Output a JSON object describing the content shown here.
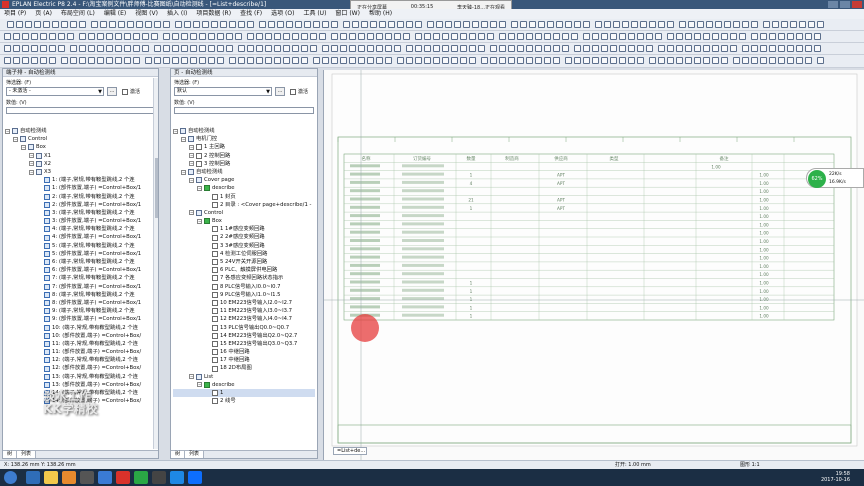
{
  "window": {
    "title": "EPLAN Electric P8 2.4 - F:\\淘宝案例文件\\胖师傅-比赛图纸\\自动检测线 - [=List+describe/1]"
  },
  "sharing": {
    "status": "正在分享屏幕",
    "time": "00:35:15",
    "viewer": "李天臻-18...正在观看"
  },
  "menu": [
    "项目 (P)",
    "页 (A)",
    "布局空间 (L)",
    "编辑 (E)",
    "视图 (V)",
    "插入 (I)",
    "项目数据 (R)",
    "查找 (F)",
    "选项 (O)",
    "工具 (U)",
    "窗口 (W)",
    "帮助 (H)"
  ],
  "left_panel": {
    "title": "端子排 - 自动检测线",
    "filter_label": "筛选器: (F)",
    "filter_value": "- 未激活 -",
    "activate_label": "激活",
    "value_label": "数值: (V)",
    "tree": [
      {
        "label": "自动检测线",
        "indent": 0
      },
      {
        "label": "Control",
        "indent": 1
      },
      {
        "label": "Box",
        "indent": 2
      },
      {
        "label": "X1",
        "indent": 3
      },
      {
        "label": "X2",
        "indent": 3
      },
      {
        "label": "X3",
        "indent": 3
      },
      {
        "label": "1: (端子,常规,带有鞍型跳线,2 个连",
        "indent": 4
      },
      {
        "label": "1: (部件放置,端子) =Control+Box/1",
        "indent": 4
      },
      {
        "label": "2: (端子,常规,带有鞍型跳线,2 个连",
        "indent": 4
      },
      {
        "label": "2: (部件放置,端子) =Control+Box/1",
        "indent": 4
      },
      {
        "label": "3: (端子,常规,带有鞍型跳线,2 个连",
        "indent": 4
      },
      {
        "label": "3: (部件放置,端子) =Control+Box/1",
        "indent": 4
      },
      {
        "label": "4: (端子,常规,带有鞍型跳线,2 个连",
        "indent": 4
      },
      {
        "label": "4: (部件放置,端子) =Control+Box/1",
        "indent": 4
      },
      {
        "label": "5: (端子,常规,带有鞍型跳线,2 个连",
        "indent": 4
      },
      {
        "label": "5: (部件放置,端子) =Control+Box/1",
        "indent": 4
      },
      {
        "label": "6: (端子,常规,带有鞍型跳线,2 个连",
        "indent": 4
      },
      {
        "label": "6: (部件放置,端子) =Control+Box/1",
        "indent": 4
      },
      {
        "label": "7: (端子,常规,带有鞍型跳线,2 个连",
        "indent": 4
      },
      {
        "label": "7: (部件放置,端子) =Control+Box/1",
        "indent": 4
      },
      {
        "label": "8: (端子,常规,带有鞍型跳线,2 个连",
        "indent": 4
      },
      {
        "label": "8: (部件放置,端子) =Control+Box/1",
        "indent": 4
      },
      {
        "label": "9: (端子,常规,带有鞍型跳线,2 个连",
        "indent": 4
      },
      {
        "label": "9: (部件放置,端子) =Control+Box/1",
        "indent": 4
      },
      {
        "label": "10: (端子,常规,带有鞍型跳线,2 个连",
        "indent": 4
      },
      {
        "label": "10: (部件放置,端子) =Control+Box/",
        "indent": 4
      },
      {
        "label": "11: (端子,常规,带有鞍型跳线,2 个连",
        "indent": 4
      },
      {
        "label": "11: (部件放置,端子) =Control+Box/",
        "indent": 4
      },
      {
        "label": "12: (端子,常规,带有鞍型跳线,2 个连",
        "indent": 4
      },
      {
        "label": "12: (部件放置,端子) =Control+Box/",
        "indent": 4
      },
      {
        "label": "13: (端子,常规,带有鞍型跳线,2 个连",
        "indent": 4
      },
      {
        "label": "13: (部件放置,端子) =Control+Box/",
        "indent": 4
      },
      {
        "label": "14: (端子,常规,带有鞍型跳线,2 个连",
        "indent": 4
      },
      {
        "label": "14: (部件放置,端子) =Control+Box/",
        "indent": 4
      }
    ],
    "tabs": [
      "树",
      "列表"
    ]
  },
  "mid_panel": {
    "title": "页 - 自动检测线",
    "filter_label": "筛选器: (F)",
    "filter_value": "默认",
    "activate_label": "激活",
    "value_label": "数值: (V)",
    "tree": [
      {
        "label": "自动检测线",
        "indent": 0,
        "icon": "folder"
      },
      {
        "label": "电机门控",
        "indent": 1,
        "icon": "folder"
      },
      {
        "label": "1 主回路",
        "indent": 2,
        "icon": "page"
      },
      {
        "label": "2 控制回路",
        "indent": 2,
        "icon": "page"
      },
      {
        "label": "3 控制回路",
        "indent": 2,
        "icon": "page"
      },
      {
        "label": "自动检测线",
        "indent": 1,
        "icon": "folder"
      },
      {
        "label": "Cover page",
        "indent": 2,
        "icon": "folder"
      },
      {
        "label": "describe",
        "indent": 3,
        "icon": "green"
      },
      {
        "label": "1 封页",
        "indent": 4,
        "icon": "page"
      },
      {
        "label": "2 目录 : <Cover page+describe/1 - ",
        "indent": 4,
        "icon": "page"
      },
      {
        "label": "Control",
        "indent": 2,
        "icon": "folder"
      },
      {
        "label": "Box",
        "indent": 3,
        "icon": "green"
      },
      {
        "label": "1 1#感应变频回路",
        "indent": 4,
        "icon": "page"
      },
      {
        "label": "2 2#感应变频回路",
        "indent": 4,
        "icon": "page"
      },
      {
        "label": "3 3#感应变频回路",
        "indent": 4,
        "icon": "page"
      },
      {
        "label": "4 检测工位伺服回路",
        "indent": 4,
        "icon": "page"
      },
      {
        "label": "5 24V开关开源回路",
        "indent": 4,
        "icon": "page"
      },
      {
        "label": "6 PLC、触摸屏供电回路",
        "indent": 4,
        "icon": "page"
      },
      {
        "label": "7 各感应变频回路状态指示",
        "indent": 4,
        "icon": "page"
      },
      {
        "label": "8 PLC信号输入I0.0~I0.7",
        "indent": 4,
        "icon": "page"
      },
      {
        "label": "9 PLC信号输入I1.0~I1.5",
        "indent": 4,
        "icon": "page"
      },
      {
        "label": "10 EM223信号输入I2.0~I2.7",
        "indent": 4,
        "icon": "page"
      },
      {
        "label": "11 EM223信号输入I3.0~I3.7",
        "indent": 4,
        "icon": "page"
      },
      {
        "label": "12 EM223信号输入I4.0~I4.7",
        "indent": 4,
        "icon": "page"
      },
      {
        "label": "13 PLC信号输出Q0.0~Q0.7",
        "indent": 4,
        "icon": "page"
      },
      {
        "label": "14 EM223信号输出Q2.0~Q2.7",
        "indent": 4,
        "icon": "page"
      },
      {
        "label": "15 EM223信号输出Q3.0~Q3.7",
        "indent": 4,
        "icon": "page"
      },
      {
        "label": "16 中继回路",
        "indent": 4,
        "icon": "page"
      },
      {
        "label": "17 中继回路",
        "indent": 4,
        "icon": "page"
      },
      {
        "label": "18 2D布局图",
        "indent": 4,
        "icon": "page"
      },
      {
        "label": "List",
        "indent": 2,
        "icon": "folder"
      },
      {
        "label": "describe",
        "indent": 3,
        "icon": "green"
      },
      {
        "label": "1",
        "indent": 4,
        "icon": "page",
        "selected": true
      },
      {
        "label": "2 线号",
        "indent": 4,
        "icon": "page"
      }
    ],
    "tabs": [
      "树",
      "列表"
    ]
  },
  "drawing": {
    "doc_tab": "=List+de...",
    "table_headers": [
      "名称",
      "订货编号",
      "数量",
      "制造商",
      "供应商",
      "类型",
      "备注"
    ],
    "rows": [
      [
        "",
        "",
        "",
        "",
        "",
        "",
        "",
        "1.00"
      ],
      [
        "塑壳断路器",
        "",
        "1",
        "",
        "APT",
        "",
        "1.00"
      ],
      [
        "微型断路器",
        "",
        "4",
        "",
        "APT",
        "",
        "1.00"
      ],
      [
        "",
        "",
        "",
        "",
        "",
        "",
        "1.00"
      ],
      [
        "",
        "",
        "21",
        "",
        "APT",
        "",
        "1.00"
      ],
      [
        "",
        "",
        "1",
        "",
        "APT",
        "",
        "1.00"
      ],
      [
        "",
        "",
        "",
        "",
        "",
        "",
        "1.00"
      ],
      [
        "",
        "",
        "",
        "",
        "",
        "",
        "1.00"
      ],
      [
        "",
        "",
        "",
        "",
        "",
        "",
        "1.00"
      ],
      [
        "",
        "",
        "",
        "",
        "",
        "",
        "1.00"
      ],
      [
        "",
        "",
        "",
        "",
        "",
        "",
        "1.00"
      ],
      [
        "",
        "",
        "",
        "",
        "",
        "",
        "1.00"
      ],
      [
        "",
        "",
        "",
        "",
        "",
        "",
        "1.00"
      ],
      [
        "",
        "",
        "",
        "",
        "",
        "",
        "1.00"
      ],
      [
        "",
        "",
        "1",
        "",
        "",
        "",
        "1.00"
      ],
      [
        "",
        "",
        "1",
        "",
        "",
        "",
        "1.00"
      ],
      [
        "",
        "",
        "1",
        "",
        "",
        "",
        "1.00"
      ],
      [
        "",
        "",
        "1",
        "",
        "",
        "",
        "1.00"
      ],
      [
        "",
        "",
        "1",
        "",
        "",
        "",
        "1.00"
      ]
    ]
  },
  "status": {
    "coords": "X: 138.26 mm  Y: 138.26 mm",
    "grid": "打开: 1.00 mm",
    "scale": "图形 1:1"
  },
  "network": {
    "percent": "62%",
    "up": "22K/s",
    "down": "16.9K/s"
  },
  "watermark": {
    "line1": "淡水工作",
    "line2": "KK学精校"
  },
  "clock": {
    "time": "19:58",
    "date": "2017-10-16"
  }
}
